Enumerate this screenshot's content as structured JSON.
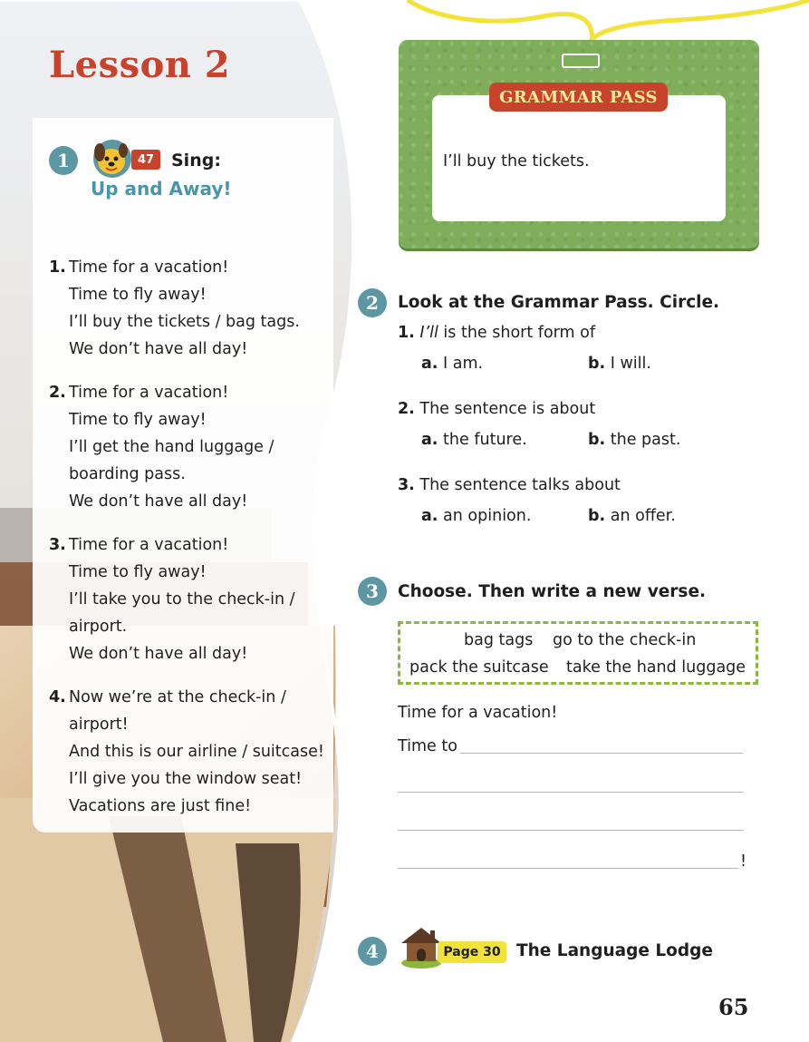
{
  "lesson": {
    "title": "Lesson 2"
  },
  "activity1": {
    "number": "1",
    "track": "47",
    "instruction": "Sing:",
    "song_title": "Up and Away!",
    "verses": [
      {
        "number": "1.",
        "lines": [
          "Time for a vacation!",
          "Time to fly away!",
          "I’ll buy the tickets / bag tags.",
          "We don’t have all day!"
        ]
      },
      {
        "number": "2.",
        "lines": [
          "Time for a vacation!",
          "Time to fly away!",
          "I’ll get the hand luggage /",
          "boarding pass.",
          "We don’t have all day!"
        ]
      },
      {
        "number": "3.",
        "lines": [
          "Time for a vacation!",
          "Time to fly away!",
          "I’ll take you to the check-in /",
          "airport.",
          "We don’t have all day!"
        ]
      },
      {
        "number": "4.",
        "lines": [
          "Now we’re at the check-in /",
          "airport!",
          "And this is our airline / suitcase!",
          "I’ll give you the window seat!",
          "Vacations are just fine!"
        ]
      }
    ]
  },
  "grammar_pass": {
    "label": "GRAMMAR PASS",
    "sentence": "I’ll buy the tickets."
  },
  "activity2": {
    "number": "2",
    "heading": "Look at the Grammar Pass. Circle.",
    "questions": [
      {
        "number": "1.",
        "stem_italic": "I’ll",
        "stem": " is the short form of",
        "a_label": "a.",
        "a_text": "I am.",
        "b_label": "b.",
        "b_text": "I will."
      },
      {
        "number": "2.",
        "stem_italic": "",
        "stem": "The sentence is about",
        "a_label": "a.",
        "a_text": "the future.",
        "b_label": "b.",
        "b_text": "the past."
      },
      {
        "number": "3.",
        "stem_italic": "",
        "stem": "The sentence talks about",
        "a_label": "a.",
        "a_text": "an opinion.",
        "b_label": "b.",
        "b_text": "an offer."
      }
    ]
  },
  "activity3": {
    "number": "3",
    "heading": "Choose. Then write a new verse.",
    "word_box": [
      "bag tags",
      "go to the check-in",
      "pack the suitcase",
      "take the hand luggage"
    ],
    "verse_line1": "Time for a vacation!",
    "verse_line2_start": "Time to",
    "verse_end": "!"
  },
  "activity4": {
    "number": "4",
    "page_ref": "Page 30",
    "title": "The Language Lodge"
  },
  "page_number": "65",
  "colors": {
    "accent_red": "#c8432b",
    "teal": "#5d97a3",
    "green": "#7fae5a",
    "yellow": "#f2e33a"
  }
}
